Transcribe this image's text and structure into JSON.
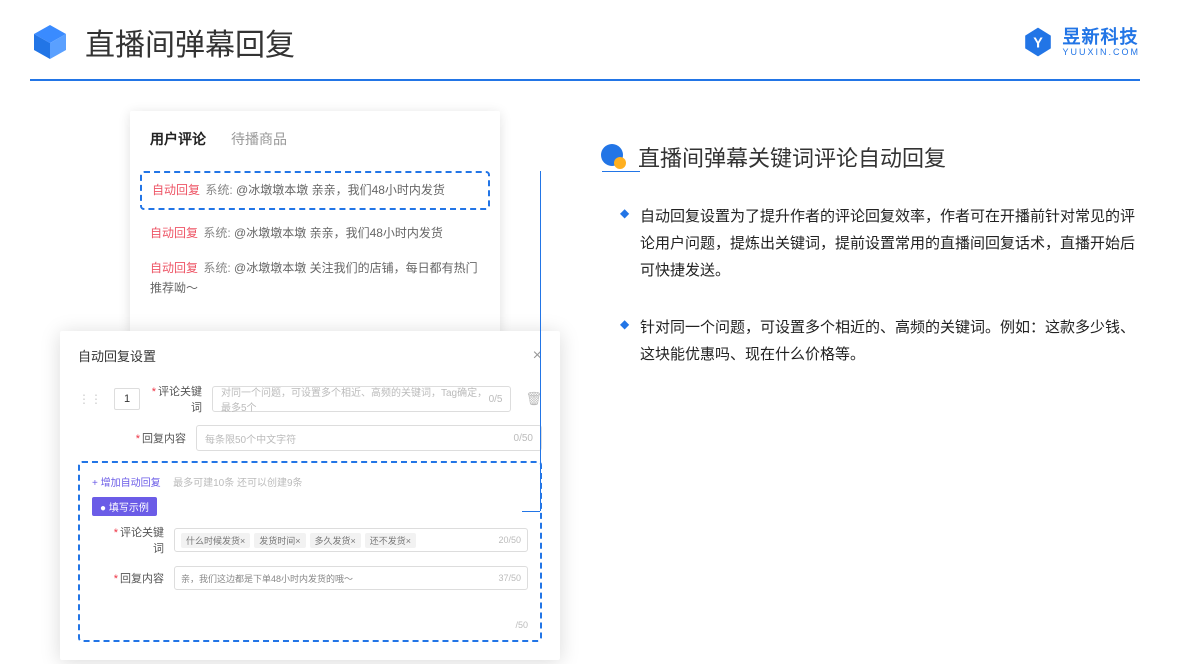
{
  "header": {
    "title": "直播间弹幕回复",
    "brand_cn": "昱新科技",
    "brand_url": "YUUXIN.COM"
  },
  "right": {
    "title": "直播间弹幕关键词评论自动回复",
    "bullets": [
      "自动回复设置为了提升作者的评论回复效率，作者可在开播前针对常见的评论用户问题，提炼出关键词，提前设置常用的直播间回复话术，直播开始后可快捷发送。",
      "针对同一个问题，可设置多个相近的、高频的关键词。例如：这款多少钱、这块能优惠吗、现在什么价格等。"
    ]
  },
  "card1": {
    "tab1": "用户评论",
    "tab2": "待播商品",
    "c1_ar": "自动回复",
    "c1_sys": "系统:",
    "c1_txt": "@冰墩墩本墩 亲亲，我们48小时内发货",
    "c2_ar": "自动回复",
    "c2_sys": "系统:",
    "c2_txt": "@冰墩墩本墩 亲亲，我们48小时内发货",
    "c3_ar": "自动回复",
    "c3_sys": "系统:",
    "c3_txt": "@冰墩墩本墩 关注我们的店铺，每日都有热门推荐呦～"
  },
  "card2": {
    "title": "自动回复设置",
    "num": "1",
    "lbl_kw": "评论关键词",
    "ph_kw": "对同一个问题，可设置多个相近、高频的关键词，Tag确定，最多5个",
    "cnt_kw": "0/5",
    "lbl_rc": "回复内容",
    "ph_rc": "每条限50个中文字符",
    "cnt_rc": "0/50",
    "add_link": "+ 增加自动回复",
    "add_hint": "最多可建10条 还可以创建9条",
    "badge": "● 填写示例",
    "ex_lbl_kw": "评论关键词",
    "tag1": "什么时候发货×",
    "tag2": "发货时间×",
    "tag3": "多久发货×",
    "tag4": "还不发货×",
    "ex_cnt_kw": "20/50",
    "ex_lbl_rc": "回复内容",
    "ex_rc": "亲，我们这边都是下单48小时内发货的哦～",
    "ex_cnt_rc": "37/50",
    "cnt_bottom": "/50"
  }
}
